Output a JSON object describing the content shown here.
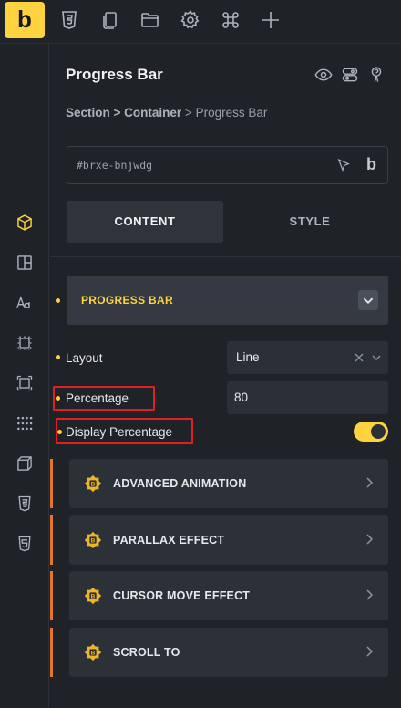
{
  "toolbar": {
    "logo": "b",
    "icons": [
      "css3-icon",
      "copy-icon",
      "folder-icon",
      "gear-icon",
      "command-icon",
      "plus-icon"
    ]
  },
  "rail": {
    "icons": [
      "cube-icon",
      "layout-icon",
      "typography-icon",
      "element-icon",
      "frame-icon",
      "grid-dots-icon",
      "box-3d-icon",
      "css3-icon",
      "html5-icon"
    ],
    "active": "cube-icon"
  },
  "panel": {
    "title": "Progress Bar",
    "breadcrumb": {
      "section": "Section",
      "sep1": " > ",
      "container": "Container",
      "sep2": " > ",
      "current": "Progress Bar"
    },
    "element_id": "#brxe-bnjwdg",
    "id_suffix_icon": "b",
    "tabs": [
      {
        "label": "CONTENT",
        "active": true
      },
      {
        "label": "STYLE",
        "active": false
      }
    ],
    "section": {
      "label": "PROGRESS BAR"
    },
    "controls": {
      "layout": {
        "label": "Layout",
        "value": "Line"
      },
      "percentage": {
        "label": "Percentage",
        "value": "80"
      },
      "display_percentage": {
        "label": "Display Percentage",
        "enabled": true
      }
    },
    "accordions": [
      {
        "label": "ADVANCED ANIMATION"
      },
      {
        "label": "PARALLAX EFFECT"
      },
      {
        "label": "CURSOR MOVE EFFECT"
      },
      {
        "label": "SCROLL TO"
      }
    ]
  },
  "colors": {
    "accent": "#ffd23f",
    "panel_bg": "#1f2328",
    "highlight": "#e02020",
    "addon_bar": "#e2762d"
  }
}
